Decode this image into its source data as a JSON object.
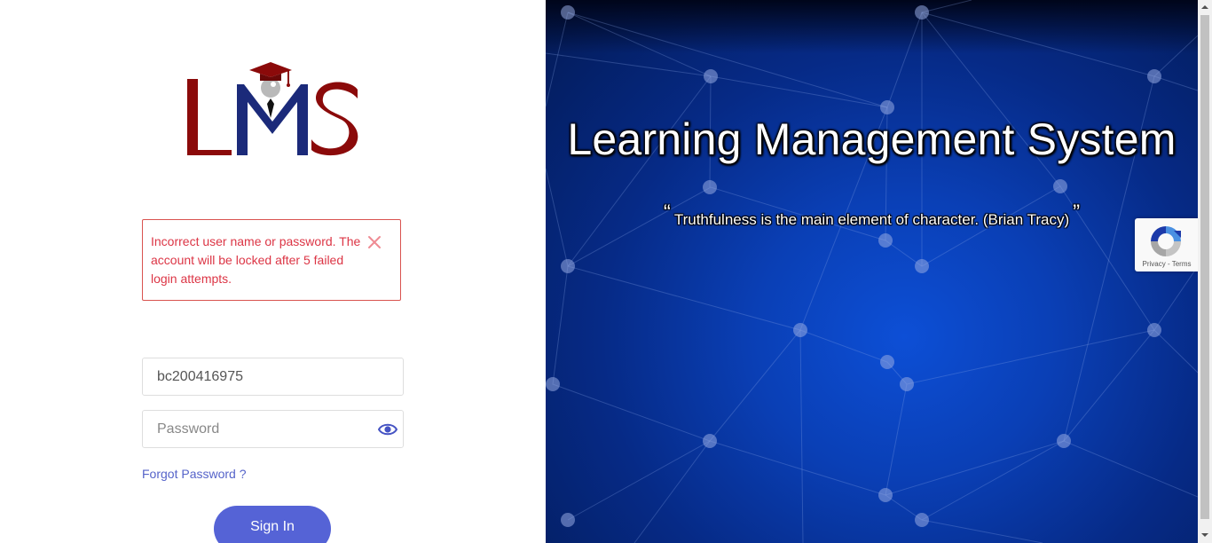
{
  "logo": {
    "text": "LMS"
  },
  "alert": {
    "message": "Incorrect user name or password. The account will be locked after 5 failed login attempts."
  },
  "login": {
    "username_value": "bc200416975",
    "password_placeholder": "Password",
    "forgot_label": "Forgot Password ?",
    "signin_label": "Sign In"
  },
  "hero": {
    "title": "Learning Management System",
    "open_quote": "“",
    "quote": "Truthfulness is the main element of character. (Brian Tracy)",
    "close_quote": "”"
  },
  "recaptcha": {
    "links": "Privacy - Terms"
  },
  "colors": {
    "accent": "#5563d6",
    "error": "#dc3545",
    "logo_red": "#8b0a0a",
    "logo_navy": "#1b2a7a",
    "hero_blue": "#0a3fb5"
  },
  "icons": [
    "close-icon",
    "eye-icon",
    "recaptcha-icon",
    "graduation-cap-icon"
  ]
}
